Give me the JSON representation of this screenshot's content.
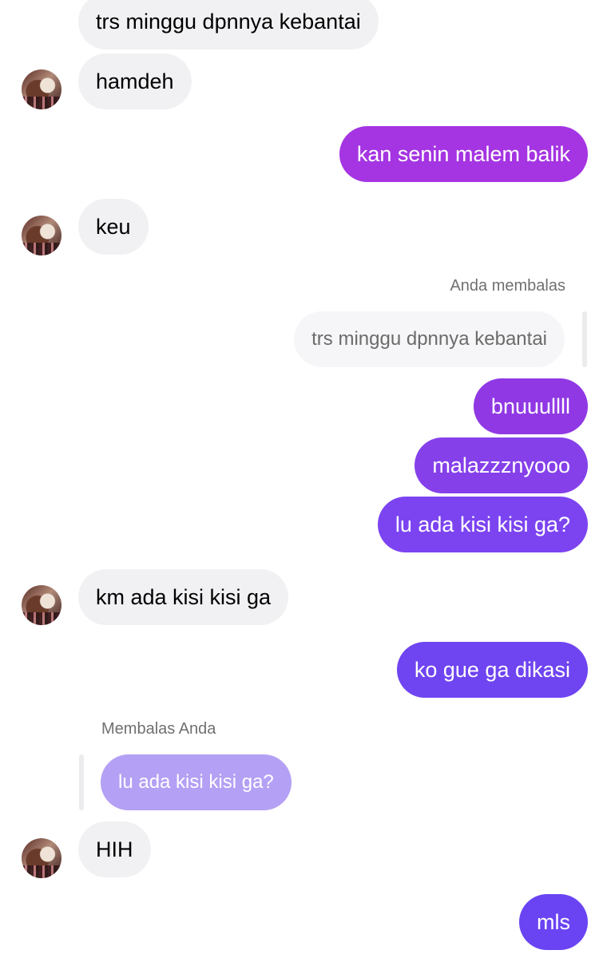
{
  "colors": {
    "incoming_bubble": "#f1f1f3",
    "outgoing_magenta": "#a534e2",
    "outgoing_purple": "#7c44f0",
    "outgoing_blue_violet": "#6a44f2",
    "quoted_incoming": "#b4a0f4"
  },
  "messages": [
    {
      "text": "trs minggu dpnnya kebantai"
    },
    {
      "text": "hamdeh"
    },
    {
      "text": "kan senin malem balik"
    },
    {
      "text": "keu"
    },
    {
      "reply_label": "Anda membalas",
      "quoted": "trs minggu dpnnya kebantai"
    },
    {
      "text": "bnuuullll"
    },
    {
      "text": "malazzznyooo"
    },
    {
      "text": "lu ada kisi kisi ga?"
    },
    {
      "text": "km ada kisi kisi ga"
    },
    {
      "text": "ko gue ga dikasi"
    },
    {
      "reply_label": "Membalas Anda",
      "quoted": "lu ada kisi kisi ga?"
    },
    {
      "text": "HIH"
    },
    {
      "text": "mls"
    }
  ]
}
